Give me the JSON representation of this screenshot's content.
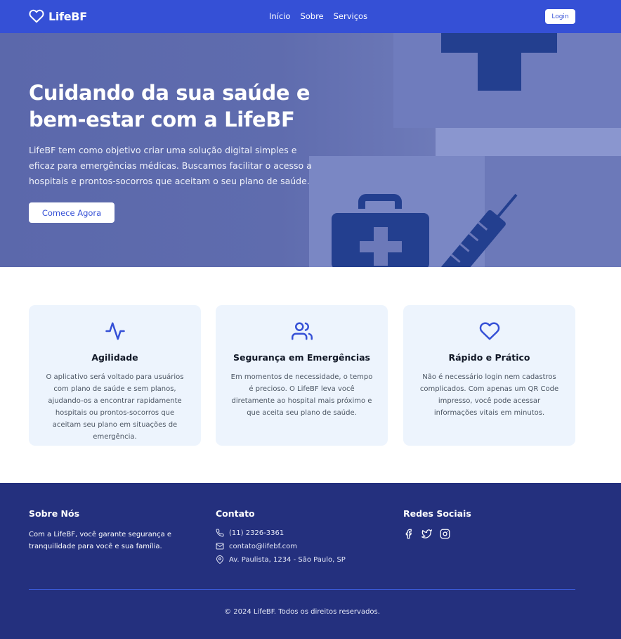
{
  "nav": {
    "brand": "LifeBF",
    "links": [
      "Início",
      "Sobre",
      "Serviços"
    ],
    "login_label": "Login"
  },
  "hero": {
    "title": "Cuidando da sua saúde e bem-estar com a LifeBF",
    "description": "LifeBF tem como objetivo criar uma solução digital simples e eficaz para emergências médicas. Buscamos facilitar o acesso a hospitais e prontos-socorros que aceitam o seu plano de saúde.",
    "cta_label": "Comece Agora"
  },
  "features": [
    {
      "icon": "activity-icon",
      "title": "Agilidade",
      "text": "O aplicativo será voltado para usuários com plano de saúde e sem planos, ajudando-os a encontrar rapidamente hospitais ou prontos-socorros que aceitam seu plano em situações de emergência."
    },
    {
      "icon": "users-icon",
      "title": "Segurança em Emergências",
      "text": "Em momentos de necessidade, o tempo é precioso. O LifeBF leva você diretamente ao hospital mais próximo e que aceita seu plano de saúde."
    },
    {
      "icon": "heart-icon",
      "title": "Rápido e Prático",
      "text": "Não é necessário login nem cadastros complicados. Com apenas um QR Code impresso, você pode acessar informações vitais em minutos."
    }
  ],
  "footer": {
    "about_heading": "Sobre Nós",
    "about_text": "Com a LifeBF, você garante segurança e tranquilidade para você e sua família.",
    "contact_heading": "Contato",
    "phone": "(11) 2326-3361",
    "email": "contato@lifebf.com",
    "address": "Av. Paulista, 1234 - São Paulo, SP",
    "social_heading": "Redes Sociais",
    "social": [
      "facebook-icon",
      "twitter-icon",
      "instagram-icon"
    ],
    "copyright": "© 2024 LifeBF. Todos os direitos reservados."
  },
  "colors": {
    "primary": "#3550d6",
    "hero_overlay": "#5b68ab",
    "card_bg": "#edf4fd",
    "footer_bg": "#24307e"
  }
}
